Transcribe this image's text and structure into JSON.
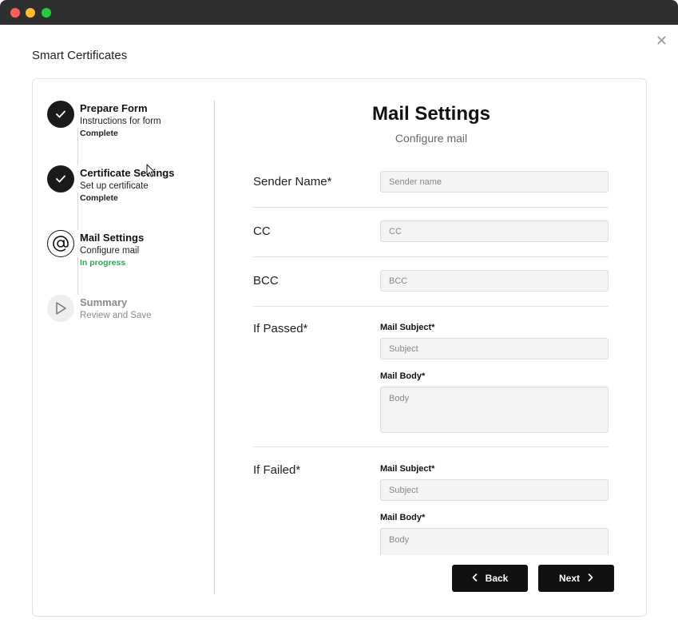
{
  "window": {
    "title": "Smart Certificates",
    "close_glyph": "✕"
  },
  "stepper": {
    "steps": [
      {
        "title": "Prepare Form",
        "subtitle": "Instructions for form",
        "status": "Complete",
        "state": "done",
        "icon": "check-icon"
      },
      {
        "title": "Certificate Settings",
        "subtitle": "Set up certificate",
        "status": "Complete",
        "state": "done",
        "icon": "check-icon"
      },
      {
        "title": "Mail Settings",
        "subtitle": "Configure mail",
        "status": "In progress",
        "state": "current",
        "icon": "at-sign-icon"
      },
      {
        "title": "Summary",
        "subtitle": "Review and Save",
        "status": "",
        "state": "pending",
        "icon": "play-icon"
      }
    ]
  },
  "main": {
    "title": "Mail Settings",
    "subtitle": "Configure mail",
    "sender": {
      "label": "Sender Name*",
      "placeholder": "Sender name",
      "value": ""
    },
    "cc": {
      "label": "CC",
      "placeholder": "CC",
      "value": ""
    },
    "bcc": {
      "label": "BCC",
      "placeholder": "BCC",
      "value": ""
    },
    "passed": {
      "label": "If Passed*",
      "subject_label": "Mail Subject*",
      "subject_placeholder": "Subject",
      "body_label": "Mail Body*",
      "body_placeholder": "Body"
    },
    "failed": {
      "label": "If Failed*",
      "subject_label": "Mail Subject*",
      "subject_placeholder": "Subject",
      "body_label": "Mail Body*",
      "body_placeholder": "Body"
    }
  },
  "footer": {
    "back_label": "Back",
    "next_label": "Next"
  },
  "colors": {
    "accent": "#111111",
    "in_progress": "#22b14c",
    "titlebar": "#2f2f30"
  }
}
